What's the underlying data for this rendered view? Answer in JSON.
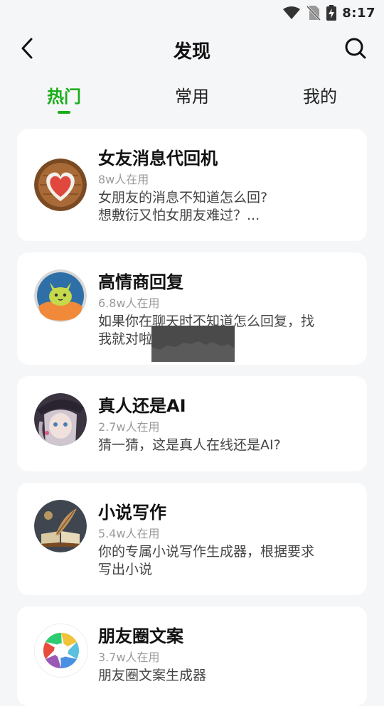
{
  "status": {
    "time": "8:17"
  },
  "header": {
    "title": "发现"
  },
  "tabs": [
    {
      "label": "热门"
    },
    {
      "label": "常用"
    },
    {
      "label": "我的"
    }
  ],
  "cards": [
    {
      "title": "女友消息代回机",
      "users": "8w人在用",
      "desc_lines": [
        "女朋友的消息不知道怎么回?",
        "想敷衍又怕女朋友难过？..."
      ],
      "avatar": "heart-icon"
    },
    {
      "title": "高情商回复",
      "users": "6.8w人在用",
      "desc_lines": [
        "如果你在聊天时不知道怎么回复，找",
        "我就对啦"
      ],
      "avatar": "cat-icon"
    },
    {
      "title": "真人还是AI",
      "users": "2.7w人在用",
      "desc_lines": [
        "猜一猜，这是真人在线还是AI?"
      ],
      "avatar": "anime-girl-icon"
    },
    {
      "title": "小说写作",
      "users": "5.4w人在用",
      "desc_lines": [
        "你的专属小说写作生成器，根据要求",
        "写出小说"
      ],
      "avatar": "book-quill-icon"
    },
    {
      "title": "朋友圈文案",
      "users": "3.7w人在用",
      "desc_lines": [
        "朋友圈文案生成器"
      ],
      "avatar": "aperture-icon"
    }
  ],
  "colors": {
    "accent": "#1aad19",
    "background": "#f5f6f8",
    "card": "#ffffff"
  }
}
